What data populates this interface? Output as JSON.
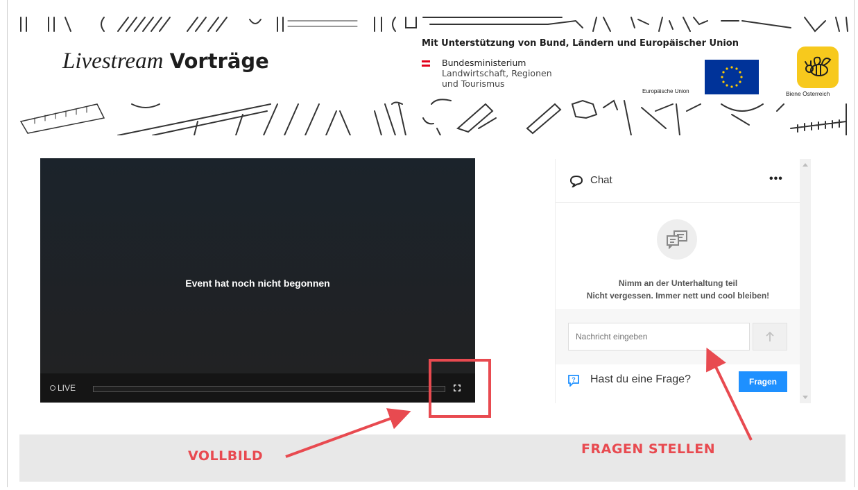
{
  "header": {
    "brand_script": "Livestream",
    "brand_bold": "Vorträge",
    "support_line": "Mit Unterstützung von Bund, Ländern und Europäischer Union",
    "ministry_line1": "Bundesministerium",
    "ministry_line2": "Landwirtschaft, Regionen",
    "ministry_line3": "und Tourismus",
    "eu_label": "Europäische Union",
    "bee_label": "Biene Österreich"
  },
  "player": {
    "message": "Event hat noch nicht begonnen",
    "live_label": "LIVE"
  },
  "chat": {
    "title": "Chat",
    "more": "•••",
    "empty_line1": "Nimm an der Unterhaltung teil",
    "empty_line2": "Nicht vergessen. Immer nett und cool bleiben!",
    "input_placeholder": "Nachricht eingeben",
    "ask_text": "Hast du eine Frage?",
    "ask_button": "Fragen"
  },
  "annotations": {
    "fullscreen_label": "VOLLBILD",
    "questions_label": "FRAGEN STELLEN",
    "color": "#e84a50"
  },
  "colors": {
    "accent_blue": "#1e90ff",
    "eu_blue": "#003399",
    "bee_yellow": "#f7c91d",
    "austria_red": "#e2001a"
  }
}
